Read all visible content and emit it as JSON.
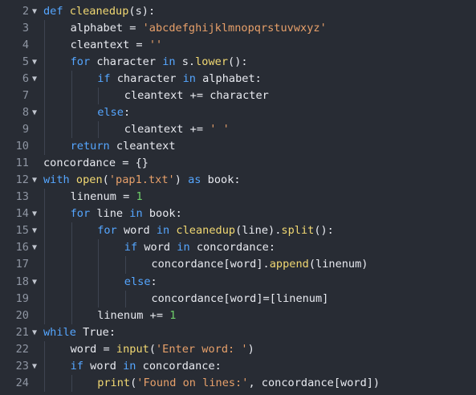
{
  "editor": {
    "fold_glyph": "▼",
    "lines": [
      {
        "num": "2",
        "fold": true,
        "indent": 0,
        "tokens": [
          {
            "t": "def ",
            "c": "kw"
          },
          {
            "t": "cleanedup",
            "c": "fn"
          },
          {
            "t": "(s):",
            "c": "pl"
          }
        ]
      },
      {
        "num": "3",
        "fold": false,
        "indent": 1,
        "tokens": [
          {
            "t": "alphabet = ",
            "c": "pl"
          },
          {
            "t": "'abcdefghijklmnopqrstuvwxyz'",
            "c": "str"
          }
        ]
      },
      {
        "num": "4",
        "fold": false,
        "indent": 1,
        "tokens": [
          {
            "t": "cleantext = ",
            "c": "pl"
          },
          {
            "t": "''",
            "c": "str"
          }
        ]
      },
      {
        "num": "5",
        "fold": true,
        "indent": 1,
        "tokens": [
          {
            "t": "for ",
            "c": "kw"
          },
          {
            "t": "character ",
            "c": "pl"
          },
          {
            "t": "in ",
            "c": "kw"
          },
          {
            "t": "s.",
            "c": "pl"
          },
          {
            "t": "lower",
            "c": "fn"
          },
          {
            "t": "():",
            "c": "pl"
          }
        ]
      },
      {
        "num": "6",
        "fold": true,
        "indent": 2,
        "tokens": [
          {
            "t": "if ",
            "c": "kw"
          },
          {
            "t": "character ",
            "c": "pl"
          },
          {
            "t": "in ",
            "c": "kw"
          },
          {
            "t": "alphabet:",
            "c": "pl"
          }
        ]
      },
      {
        "num": "7",
        "fold": false,
        "indent": 3,
        "tokens": [
          {
            "t": "cleantext += character",
            "c": "pl"
          }
        ]
      },
      {
        "num": "8",
        "fold": true,
        "indent": 2,
        "tokens": [
          {
            "t": "else",
            "c": "kw"
          },
          {
            "t": ":",
            "c": "pl"
          }
        ]
      },
      {
        "num": "9",
        "fold": false,
        "indent": 3,
        "tokens": [
          {
            "t": "cleantext += ",
            "c": "pl"
          },
          {
            "t": "' '",
            "c": "str"
          }
        ]
      },
      {
        "num": "10",
        "fold": false,
        "indent": 1,
        "tokens": [
          {
            "t": "return ",
            "c": "kw"
          },
          {
            "t": "cleantext",
            "c": "pl"
          }
        ]
      },
      {
        "num": "11",
        "fold": false,
        "indent": 0,
        "tokens": [
          {
            "t": "concordance = {}",
            "c": "pl"
          }
        ]
      },
      {
        "num": "12",
        "fold": true,
        "indent": 0,
        "tokens": [
          {
            "t": "with ",
            "c": "kw"
          },
          {
            "t": "open",
            "c": "fn"
          },
          {
            "t": "(",
            "c": "pl"
          },
          {
            "t": "'pap1.txt'",
            "c": "str"
          },
          {
            "t": ") ",
            "c": "pl"
          },
          {
            "t": "as ",
            "c": "kw"
          },
          {
            "t": "book:",
            "c": "pl"
          }
        ]
      },
      {
        "num": "13",
        "fold": false,
        "indent": 1,
        "tokens": [
          {
            "t": "linenum = ",
            "c": "pl"
          },
          {
            "t": "1",
            "c": "num"
          }
        ]
      },
      {
        "num": "14",
        "fold": true,
        "indent": 1,
        "tokens": [
          {
            "t": "for ",
            "c": "kw"
          },
          {
            "t": "line ",
            "c": "pl"
          },
          {
            "t": "in ",
            "c": "kw"
          },
          {
            "t": "book:",
            "c": "pl"
          }
        ]
      },
      {
        "num": "15",
        "fold": true,
        "indent": 2,
        "tokens": [
          {
            "t": "for ",
            "c": "kw"
          },
          {
            "t": "word ",
            "c": "pl"
          },
          {
            "t": "in ",
            "c": "kw"
          },
          {
            "t": "cleanedup",
            "c": "fn"
          },
          {
            "t": "(line).",
            "c": "pl"
          },
          {
            "t": "split",
            "c": "fn"
          },
          {
            "t": "():",
            "c": "pl"
          }
        ]
      },
      {
        "num": "16",
        "fold": true,
        "indent": 3,
        "tokens": [
          {
            "t": "if ",
            "c": "kw"
          },
          {
            "t": "word ",
            "c": "pl"
          },
          {
            "t": "in ",
            "c": "kw"
          },
          {
            "t": "concordance:",
            "c": "pl"
          }
        ]
      },
      {
        "num": "17",
        "fold": false,
        "indent": 4,
        "tokens": [
          {
            "t": "concordance[word].",
            "c": "pl"
          },
          {
            "t": "append",
            "c": "fn"
          },
          {
            "t": "(linenum)",
            "c": "pl"
          }
        ]
      },
      {
        "num": "18",
        "fold": true,
        "indent": 3,
        "tokens": [
          {
            "t": "else",
            "c": "kw"
          },
          {
            "t": ":",
            "c": "pl"
          }
        ]
      },
      {
        "num": "19",
        "fold": false,
        "indent": 4,
        "tokens": [
          {
            "t": "concordance[word]=[linenum]",
            "c": "pl"
          }
        ]
      },
      {
        "num": "20",
        "fold": false,
        "indent": 2,
        "tokens": [
          {
            "t": "linenum += ",
            "c": "pl"
          },
          {
            "t": "1",
            "c": "num"
          }
        ]
      },
      {
        "num": "21",
        "fold": true,
        "indent": 0,
        "tokens": [
          {
            "t": "while ",
            "c": "kw"
          },
          {
            "t": "True:",
            "c": "pl"
          }
        ]
      },
      {
        "num": "22",
        "fold": false,
        "indent": 1,
        "tokens": [
          {
            "t": "word = ",
            "c": "pl"
          },
          {
            "t": "input",
            "c": "fn"
          },
          {
            "t": "(",
            "c": "pl"
          },
          {
            "t": "'Enter word: '",
            "c": "str"
          },
          {
            "t": ")",
            "c": "pl"
          }
        ]
      },
      {
        "num": "23",
        "fold": true,
        "indent": 1,
        "tokens": [
          {
            "t": "if ",
            "c": "kw"
          },
          {
            "t": "word ",
            "c": "pl"
          },
          {
            "t": "in ",
            "c": "kw"
          },
          {
            "t": "concordance:",
            "c": "pl"
          }
        ]
      },
      {
        "num": "24",
        "fold": false,
        "indent": 2,
        "tokens": [
          {
            "t": "print",
            "c": "fn"
          },
          {
            "t": "(",
            "c": "pl"
          },
          {
            "t": "'Found on lines:'",
            "c": "str"
          },
          {
            "t": ", concordance[word])",
            "c": "pl"
          }
        ]
      }
    ]
  }
}
